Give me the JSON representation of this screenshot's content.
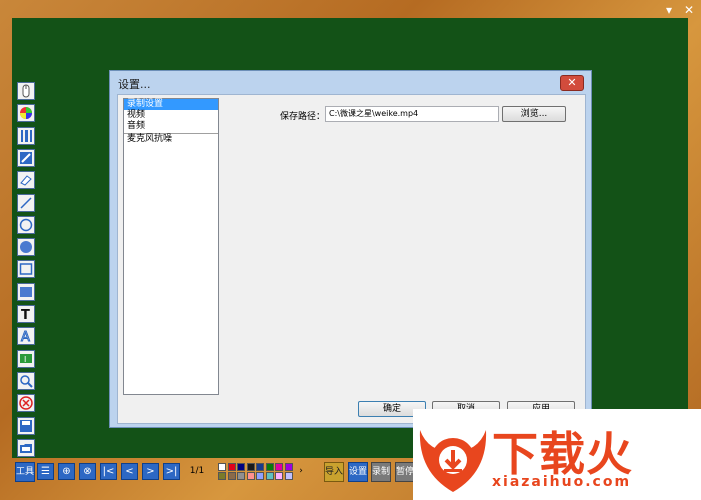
{
  "window": {
    "minimize_glyph": "▾",
    "close_glyph": "✕"
  },
  "dialog": {
    "title": "设置...",
    "close_glyph": "✕",
    "categories": [
      "录制设置",
      "视频",
      "音频",
      "麦克风抗噪"
    ],
    "selected_index": 0,
    "save_path_label": "保存路径：",
    "save_path_value": "C:\\微课之星\\weike.mp4",
    "browse_label": "浏览...",
    "ok_label": "确定",
    "cancel_label": "取消",
    "apply_label": "应用"
  },
  "tools": [
    "mouse-icon",
    "color-wheel-icon",
    "line-width-icon",
    "highlighter-icon",
    "eraser-icon",
    "line-icon",
    "circle-outline-icon",
    "circle-filled-icon",
    "rect-outline-icon",
    "rect-filled-icon",
    "text-icon",
    "text-outline-icon",
    "insert-text-icon",
    "zoom-icon",
    "clear-icon",
    "save-icon",
    "open-folder-icon"
  ],
  "toolbar": {
    "tools_label": "工具",
    "page_indicator": "1/1",
    "import_label": "导入",
    "settings_label": "设置",
    "record_label": "录制",
    "pause_label": "暂停",
    "swatches": [
      "#ffffff",
      "#e0001b",
      "#000080",
      "#1a1a1a",
      "#1a3a8a",
      "#0a7a0a",
      "#e000a0",
      "#a000e0",
      "#7a7a2a",
      "#8a6a4a",
      "#909090",
      "#ff9090",
      "#90a0ff",
      "#60c0c0",
      "#ffb0ff",
      "#c0c0ff"
    ]
  },
  "watermark": {
    "brand": "下载火",
    "domain": "xiazaihuo.com"
  }
}
